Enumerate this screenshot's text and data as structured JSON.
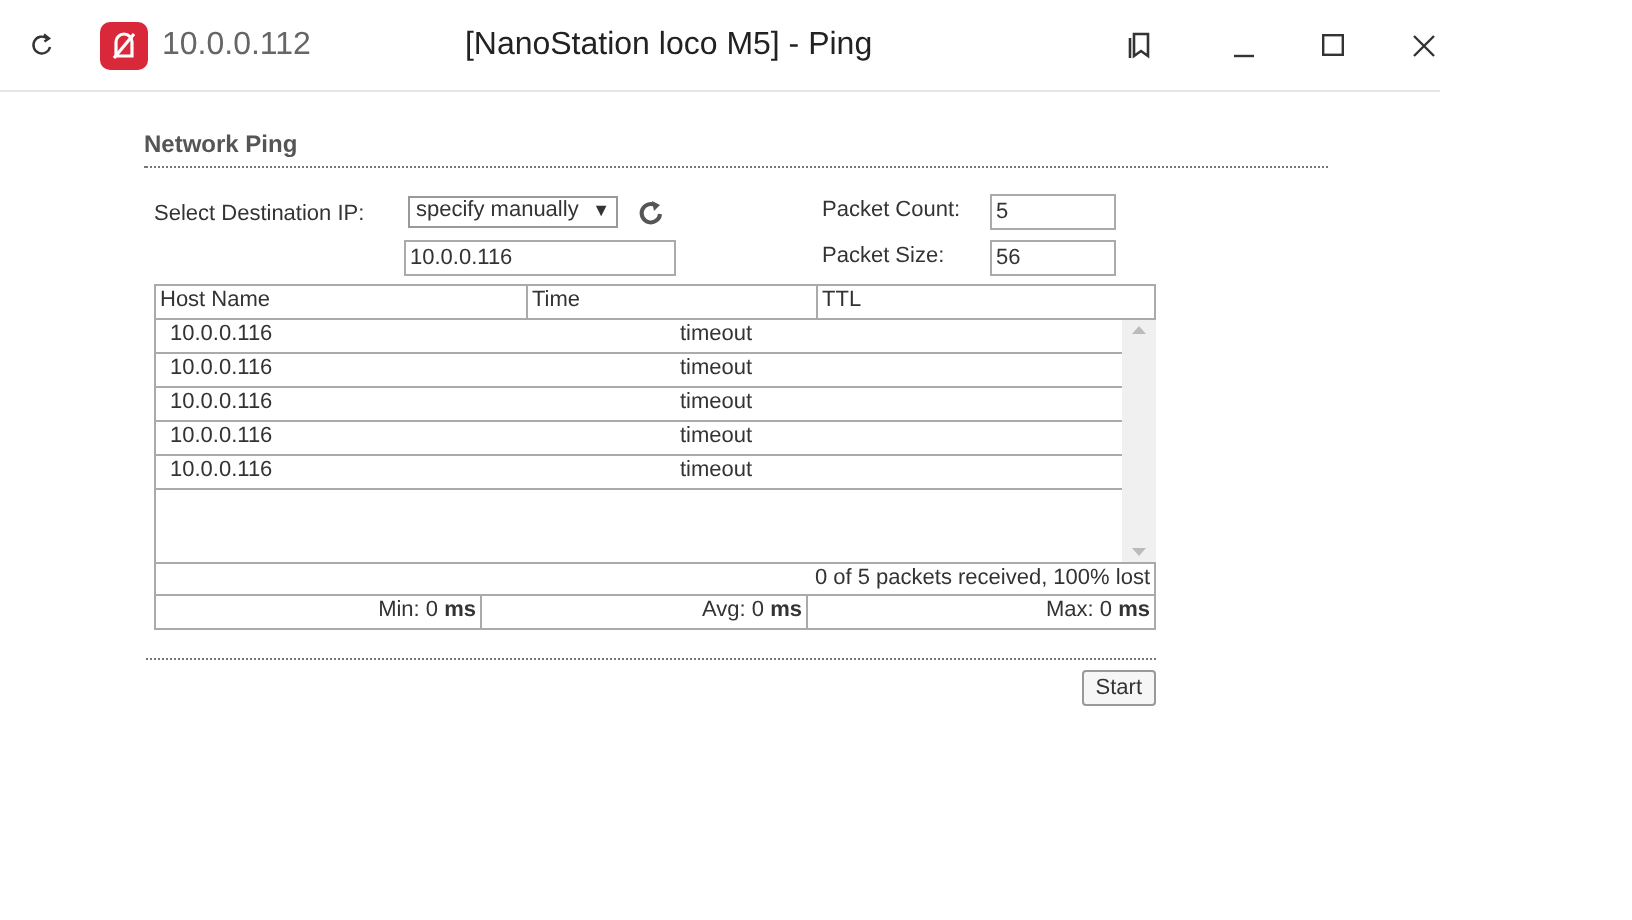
{
  "window": {
    "address": "10.0.0.112",
    "title": "[NanoStation loco M5] - Ping"
  },
  "section_title": "Network Ping",
  "form": {
    "destination_label": "Select Destination IP:",
    "destination_select": "specify manually",
    "destination_arrow": "▼",
    "ip_value": "10.0.0.116",
    "packet_count_label": "Packet Count:",
    "packet_count": "5",
    "packet_size_label": "Packet Size:",
    "packet_size": "56"
  },
  "table": {
    "columns": [
      "Host Name",
      "Time",
      "TTL"
    ],
    "rows": [
      {
        "host": "10.0.0.116",
        "time": "timeout"
      },
      {
        "host": "10.0.0.116",
        "time": "timeout"
      },
      {
        "host": "10.0.0.116",
        "time": "timeout"
      },
      {
        "host": "10.0.0.116",
        "time": "timeout"
      },
      {
        "host": "10.0.0.116",
        "time": "timeout"
      }
    ],
    "summary": "0 of 5 packets received, 100% lost",
    "stats": [
      "Min: 0 **ms**",
      "Avg: 0 **ms**",
      "Max: 0 **ms**"
    ]
  },
  "start_button": "Start"
}
